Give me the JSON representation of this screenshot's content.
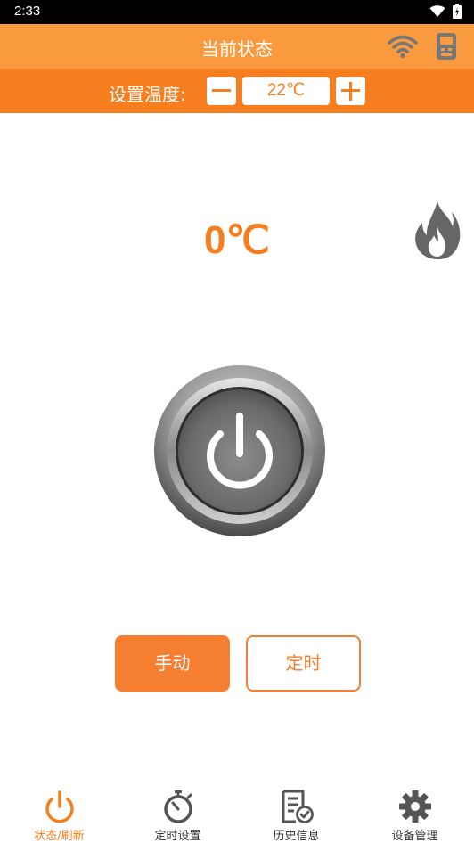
{
  "status_bar": {
    "time": "2:33",
    "icons": [
      "wifi-icon",
      "battery-icon"
    ]
  },
  "header": {
    "title": "当前状态",
    "icons": [
      "wifi-icon",
      "device-icon"
    ]
  },
  "temperature_setting": {
    "label": "设置温度:",
    "value": "22℃",
    "decrease_icon": "minus-icon",
    "increase_icon": "plus-icon"
  },
  "current": {
    "temperature": "0℃",
    "heating_icon": "flame-icon",
    "power_icon": "power-icon"
  },
  "modes": {
    "manual_label": "手动",
    "timer_label": "定时",
    "active": "manual"
  },
  "nav": {
    "items": [
      {
        "label": "状态/刷新",
        "icon": "power-icon",
        "active": true
      },
      {
        "label": "定时设置",
        "icon": "stopwatch-icon",
        "active": false
      },
      {
        "label": "历史信息",
        "icon": "history-document-icon",
        "active": false
      },
      {
        "label": "设备管理",
        "icon": "gear-icon",
        "active": false
      }
    ]
  },
  "colors": {
    "header": "#f99a3e",
    "accent": "#f67e1e",
    "button_orange": "#f67e30",
    "nav_active": "#f67e1e",
    "icon_gray": "#555555"
  }
}
